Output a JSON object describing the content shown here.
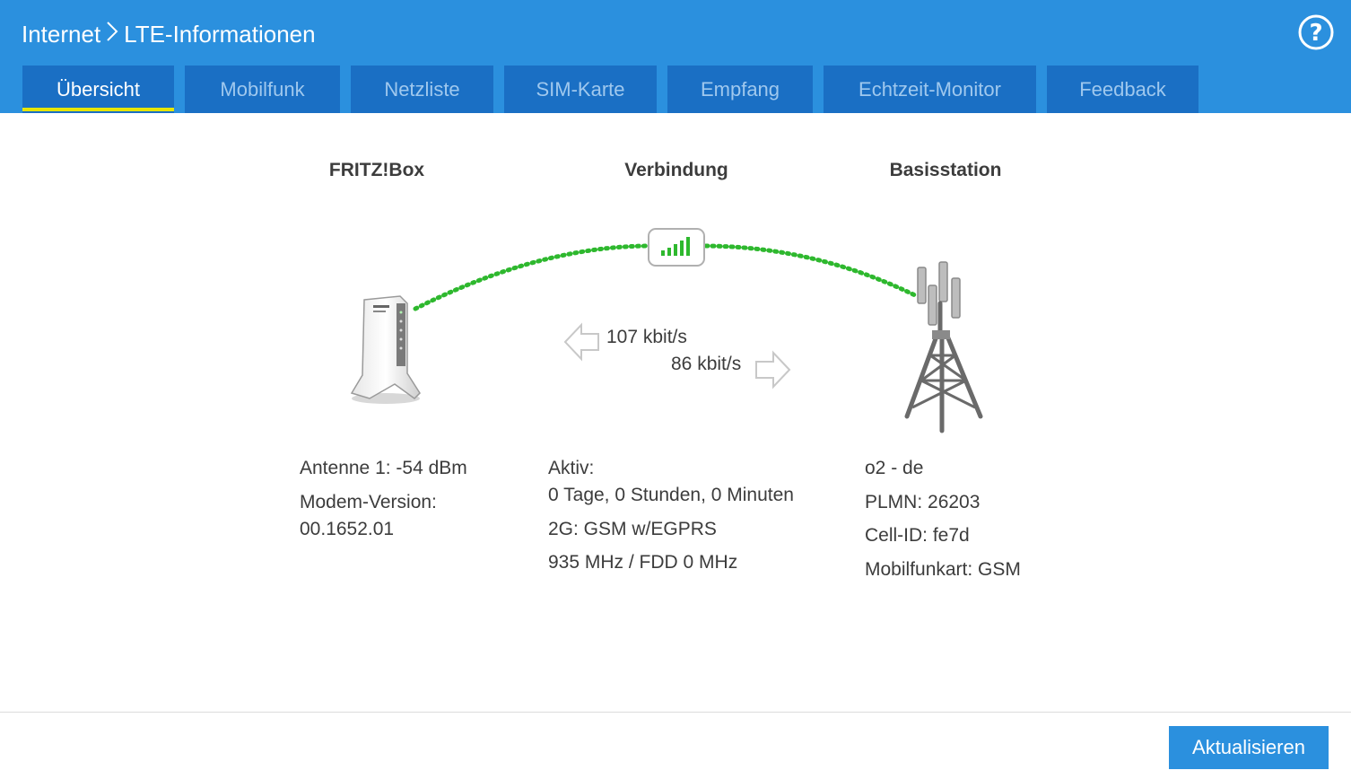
{
  "header": {
    "breadcrumb_root": "Internet",
    "breadcrumb_separator": ">",
    "breadcrumb_current": "LTE-Informationen",
    "help_icon": "question-circle-icon"
  },
  "tabs": [
    {
      "label": "Übersicht",
      "active": true
    },
    {
      "label": "Mobilfunk",
      "active": false
    },
    {
      "label": "Netzliste",
      "active": false
    },
    {
      "label": "SIM-Karte",
      "active": false
    },
    {
      "label": "Empfang",
      "active": false
    },
    {
      "label": "Echtzeit-Monitor",
      "active": false
    },
    {
      "label": "Feedback",
      "active": false
    }
  ],
  "overview": {
    "fritzbox": {
      "title": "FRITZ!Box",
      "antenna": "Antenne 1: -54 dBm",
      "modem_label": "Modem-Version:",
      "modem_version": "00.1652.01"
    },
    "connection": {
      "title": "Verbindung",
      "downstream": "107 kbit/s",
      "upstream": "86 kbit/s",
      "active_label": "Aktiv:",
      "duration": "0 Tage, 0 Stunden, 0 Minuten",
      "technology": "2G: GSM w/EGPRS",
      "frequency": "935 MHz / FDD 0 MHz"
    },
    "basestation": {
      "title": "Basisstation",
      "provider": "o2 - de",
      "plmn": "PLMN: 26203",
      "cell_id": "Cell-ID: fe7d",
      "radio_type": "Mobilfunkart: GSM"
    }
  },
  "footer": {
    "update_button": "Aktualisieren"
  },
  "colors": {
    "header_bg": "#2b90de",
    "tab_bg": "#1a6fc4",
    "tab_active_indicator": "#e6e600",
    "signal_green": "#2eb82e"
  }
}
